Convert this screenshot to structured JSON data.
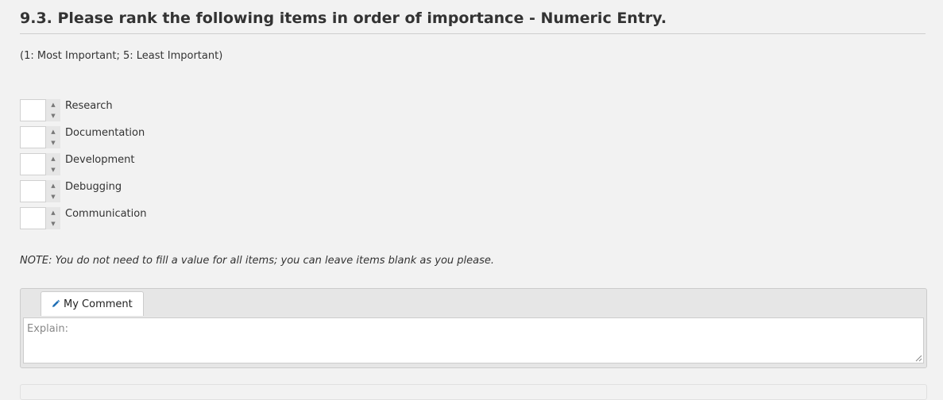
{
  "question": {
    "title": "9.3. Please rank the following items in order of importance - Numeric Entry.",
    "scale_note": "(1: Most Important; 5: Least Important)",
    "items": [
      {
        "label": "Research",
        "value": ""
      },
      {
        "label": "Documentation",
        "value": ""
      },
      {
        "label": "Development",
        "value": ""
      },
      {
        "label": "Debugging",
        "value": ""
      },
      {
        "label": "Communication",
        "value": ""
      }
    ],
    "spinner": {
      "up_icon": "caret-up-icon",
      "down_icon": "caret-down-icon"
    },
    "footnote": "NOTE: You do not need to fill a value for all items; you can leave items blank as you please."
  },
  "comment": {
    "tab_label": "My Comment",
    "tab_icon": "pencil-icon",
    "placeholder": "Explain:",
    "value": ""
  },
  "colors": {
    "page_background": "#f2f2f2",
    "text": "#333333",
    "pencil_icon": "#1f6fb5",
    "panel_background": "#e6e6e6"
  }
}
